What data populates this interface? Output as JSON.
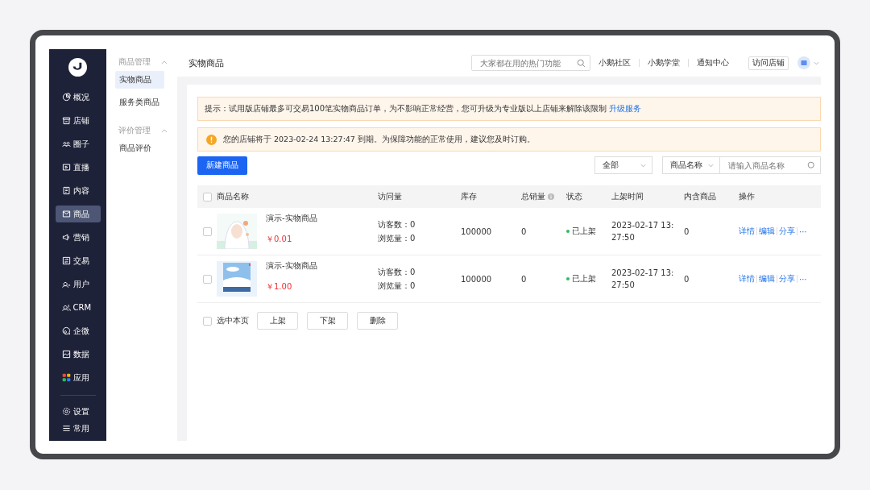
{
  "nav": [
    {
      "label": "概况",
      "selected": false
    },
    {
      "label": "店铺",
      "selected": false
    },
    {
      "label": "圈子",
      "selected": false
    },
    {
      "label": "直播",
      "selected": false
    },
    {
      "label": "内容",
      "selected": false
    },
    {
      "label": "商品",
      "selected": true
    },
    {
      "label": "营销",
      "selected": false
    },
    {
      "label": "交易",
      "selected": false
    },
    {
      "label": "用户",
      "selected": false
    },
    {
      "label": "CRM",
      "selected": false
    },
    {
      "label": "企微",
      "selected": false
    },
    {
      "label": "数据",
      "selected": false
    },
    {
      "label": "应用",
      "selected": false
    }
  ],
  "nav_bottom": [
    {
      "label": "设置"
    },
    {
      "label": "常用"
    }
  ],
  "submenu": [
    {
      "title": "商品管理",
      "expanded": true,
      "items": [
        {
          "label": "实物商品",
          "selected": true
        },
        {
          "label": "服务类商品",
          "selected": false
        }
      ]
    },
    {
      "title": "评价管理",
      "expanded": true,
      "items": [
        {
          "label": "商品评价",
          "selected": false
        }
      ]
    }
  ],
  "header": {
    "title": "实物商品",
    "search_placeholder": "大家都在用的热门功能",
    "links": [
      "小鹅社区",
      "小鹅学堂",
      "通知中心"
    ],
    "visit_button": "访问店铺"
  },
  "notice": {
    "text": "提示：试用版店铺最多可交易100笔实物商品订单，为不影响正常经营，您可升级为专业版以上店铺来解除该限制",
    "link": "升级服务"
  },
  "warning": {
    "text": "您的店铺将于 2023-02-24 13:27:47 到期。为保障功能的正常使用，建议您及时订购。"
  },
  "toolbar": {
    "new_button": "新建商品",
    "status_filter": "全部",
    "field_filter": "商品名称",
    "search_placeholder": "请输入商品名称"
  },
  "table": {
    "columns": [
      "商品名称",
      "访问量",
      "库存",
      "总销量",
      "状态",
      "上架时间",
      "内含商品",
      "操作"
    ],
    "all_checked": false,
    "rows": [
      {
        "checked": false,
        "name": "演示-实物商品",
        "price": "￥0.01",
        "visitors": "访客数：0",
        "views": "浏览量：0",
        "stock": "100000",
        "sales": "0",
        "status": "已上架",
        "color": "#2dbd5a",
        "time": "2023-02-17 13:27:50",
        "included": "0",
        "actions": [
          "详情",
          "编辑",
          "分享"
        ],
        "more": "···"
      },
      {
        "checked": false,
        "name": "演示-实物商品",
        "price": "￥1.00",
        "visitors": "访客数：0",
        "views": "浏览量：0",
        "stock": "100000",
        "sales": "0",
        "status": "已上架",
        "color": "#2dbd5a",
        "time": "2023-02-17 13:27:50",
        "included": "0",
        "actions": [
          "详情",
          "编辑",
          "分享"
        ],
        "more": "···"
      }
    ]
  },
  "bulk": {
    "select_page": "选中本页",
    "checked": false,
    "buttons": [
      "上架",
      "下架",
      "删除"
    ]
  }
}
